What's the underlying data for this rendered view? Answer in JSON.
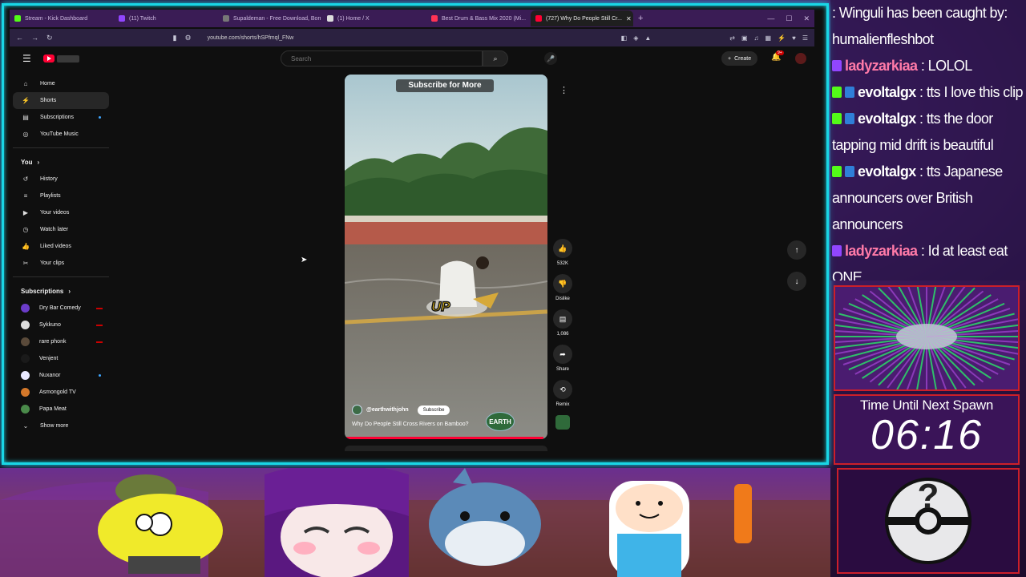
{
  "tabs": [
    {
      "label": "Stream - Kick Dashboard",
      "color": "#53fc18",
      "active": false
    },
    {
      "label": "(11) Twitch",
      "color": "#9146ff",
      "active": false
    },
    {
      "label": "Supaldeman - Free Download, Borrow...",
      "color": "#777777",
      "active": false
    },
    {
      "label": "(1) Home / X",
      "color": "#dddddd",
      "active": false
    },
    {
      "label": "Best Drum & Bass Mix 2020 (Mi...",
      "color": "#ff3355",
      "active": false
    },
    {
      "label": "(727) Why Do People Still Cr...",
      "color": "#ff0033",
      "active": true
    }
  ],
  "address": {
    "url": "youtube.com/shorts/hSPfmql_FNw"
  },
  "youtube": {
    "search_placeholder": "Search",
    "create_label": "Create",
    "bell_badge": "9+",
    "sidebar_main": [
      {
        "label": "Home",
        "icon": "home-icon",
        "glyph": "⌂",
        "active": false,
        "dot": false
      },
      {
        "label": "Shorts",
        "icon": "shorts-icon",
        "glyph": "⚡",
        "active": true,
        "dot": false
      },
      {
        "label": "Subscriptions",
        "icon": "subscriptions-icon",
        "glyph": "▤",
        "active": false,
        "dot": true
      },
      {
        "label": "YouTube Music",
        "icon": "music-icon",
        "glyph": "◎",
        "active": false,
        "dot": false
      }
    ],
    "you_heading": "You",
    "sidebar_you": [
      {
        "label": "History",
        "icon": "history-icon",
        "glyph": "↺"
      },
      {
        "label": "Playlists",
        "icon": "playlists-icon",
        "glyph": "≡"
      },
      {
        "label": "Your videos",
        "icon": "your-videos-icon",
        "glyph": "▶"
      },
      {
        "label": "Watch later",
        "icon": "watch-later-icon",
        "glyph": "◷"
      },
      {
        "label": "Liked videos",
        "icon": "liked-videos-icon",
        "glyph": "👍"
      },
      {
        "label": "Your clips",
        "icon": "clips-icon",
        "glyph": "✂"
      }
    ],
    "subscriptions_heading": "Subscriptions",
    "subscriptions": [
      {
        "label": "Dry Bar Comedy",
        "color": "#6b3cc9",
        "indicator": "live"
      },
      {
        "label": "Sykkuno",
        "color": "#dddddd",
        "indicator": "live"
      },
      {
        "label": "rare phonk",
        "color": "#5a4a3a",
        "indicator": "live"
      },
      {
        "label": "Venjent",
        "color": "#1a1a1a",
        "indicator": "none"
      },
      {
        "label": "Nuxanor",
        "color": "#e8e8ff",
        "indicator": "dot"
      },
      {
        "label": "Asmongold TV",
        "color": "#d4782a",
        "indicator": "none"
      },
      {
        "label": "Papa Meat",
        "color": "#4a8a4a",
        "indicator": "none"
      }
    ],
    "show_more_label": "Show more",
    "short": {
      "overlay_banner": "Subscribe for More",
      "caption": "UP",
      "channel": "@earthwithjohn",
      "subscribe_label": "Subscribe",
      "title": "Why Do People Still Cross Rivers on Bamboo?",
      "logo_text": "EARTH",
      "progress": 0.98
    },
    "actions": {
      "like_count": "532K",
      "dislike_label": "Dislike",
      "comments_count": "1,086",
      "share_label": "Share",
      "remix_label": "Remix"
    }
  },
  "chat": [
    {
      "user": "",
      "text": ": Winguli has been caught by: humalienfleshbot",
      "color": "#ffffff",
      "badges": []
    },
    {
      "user": "ladyzarkiaa",
      "text": " : LOLOL",
      "color": "#ff7aa8",
      "badges": [
        "#9146ff"
      ]
    },
    {
      "user": "evoltalgx",
      "text": " : tts I love this clip",
      "color": "#ffffff",
      "badges": [
        "#53fc18",
        "#2f7fd8"
      ]
    },
    {
      "user": "evoltalgx",
      "text": " : tts the door tapping mid drift is beautiful",
      "color": "#ffffff",
      "badges": [
        "#53fc18",
        "#2f7fd8"
      ]
    },
    {
      "user": "evoltalgx",
      "text": " : tts Japanese announcers over British announcers",
      "color": "#ffffff",
      "badges": [
        "#53fc18",
        "#2f7fd8"
      ]
    },
    {
      "user": "ladyzarkiaa",
      "text": " : Id at least eat ONE",
      "color": "#ff7aa8",
      "badges": [
        "#9146ff"
      ]
    }
  ],
  "timer": {
    "label": "Time Until Next Spawn",
    "value": "06:16"
  },
  "colors": {
    "frame": "#19d6e6",
    "widget_border": "#cc1f2a",
    "youtube_red": "#ff0033"
  }
}
